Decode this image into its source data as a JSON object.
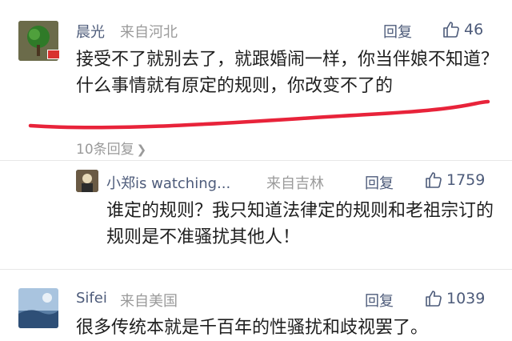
{
  "comments": [
    {
      "user": "晨光",
      "location": "来自河北",
      "reply_label": "回复",
      "likes": "46",
      "text": "接受不了就别去了，就跟婚闹一样，你当伴娘不知道？什么事情就有原定的规则，你改变不了的",
      "replies_link": "10条回复"
    },
    {
      "user": "小郑is watching...",
      "location": "来自吉林",
      "reply_label": "回复",
      "likes": "1759",
      "text": "谁定的规则？我只知道法律定的规则和老祖宗订的规则是不准骚扰其他人！"
    },
    {
      "user": "Sifei",
      "location": "来自美国",
      "reply_label": "回复",
      "likes": "1039",
      "text": "很多传统本就是千百年的性骚扰和歧视罢了。"
    }
  ],
  "colors": {
    "name": "#4d5b7a",
    "meta": "#9a9a9a",
    "underline": "#e8233a"
  }
}
